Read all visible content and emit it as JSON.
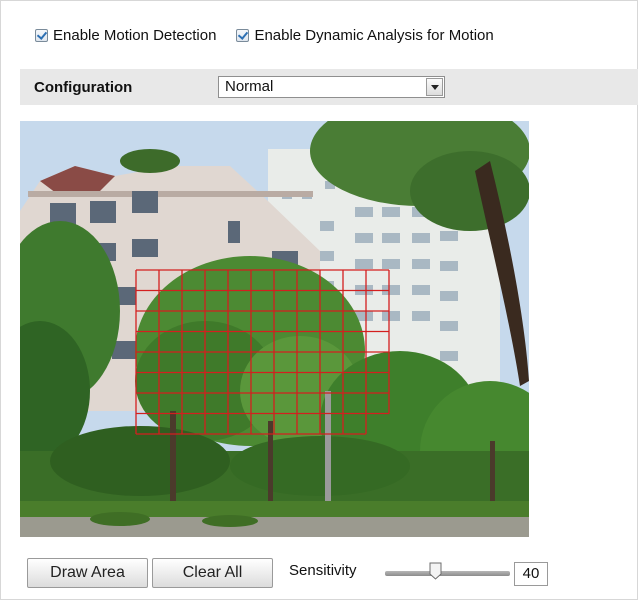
{
  "options": {
    "enable_motion_detection": {
      "label": "Enable Motion Detection",
      "checked": true
    },
    "enable_dynamic_analysis": {
      "label": "Enable Dynamic Analysis for Motion",
      "checked": true
    }
  },
  "configuration": {
    "label": "Configuration",
    "selected": "Normal"
  },
  "video": {
    "grid_color": "#d41f1f"
  },
  "toolbar": {
    "draw_area_label": "Draw Area",
    "clear_all_label": "Clear All",
    "sensitivity_label": "Sensitivity",
    "sensitivity_value": "40",
    "sensitivity_level": 0.4
  }
}
